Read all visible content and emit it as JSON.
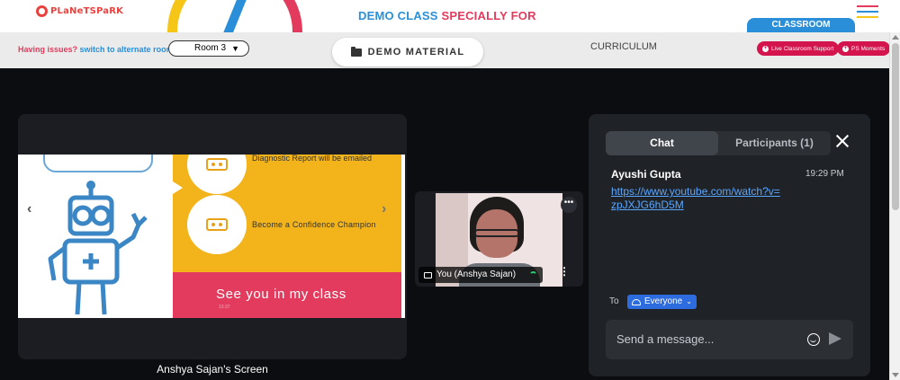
{
  "header": {
    "logo_text": "PLaNeTSPaRK",
    "title_part1": "DEMO CLASS",
    "title_part2": "SPECIALLY FOR",
    "classroom_tab": "CLASSROOM",
    "menu_icon": "hamburger-icon",
    "colors": {
      "blue": "#2a8fd8",
      "pink": "#e33b5d",
      "yellow": "#f5c518",
      "menu_lines": [
        "#e33b5d",
        "#2a8fd8",
        "#f5c518"
      ]
    }
  },
  "toolbar": {
    "issue_text": "Having issues?",
    "switch_link": "switch to alternate room",
    "room_value": "Room 3",
    "demo_material_label": "DEMO MATERIAL",
    "curriculum_label": "CURRICULUM",
    "live_support_label": "Live Classroom Support",
    "ps_moments_label": "PS Moments"
  },
  "screen_share": {
    "caption": "Anshya Sajan's Screen",
    "slide_text_1": "Diagnostic Report will be emailed",
    "slide_text_2": "Become a Confidence Champion",
    "slide_big_text": "See you in my class",
    "slide_tiny_text": "13:37"
  },
  "video": {
    "name_label": "You (Anshya Sajan)",
    "more_icon": "more-vertical-icon",
    "status_icon": "wifi-icon"
  },
  "chat": {
    "tab_chat": "Chat",
    "tab_participants": "Participants (1)",
    "messages": [
      {
        "sender": "Ayushi Gupta",
        "time": "19:29 PM",
        "text": "https://www.youtube.com/watch?v=zpJXJG6hD5M"
      }
    ],
    "to_label": "To",
    "recipient": "Everyone",
    "input_placeholder": "Send a message..."
  }
}
